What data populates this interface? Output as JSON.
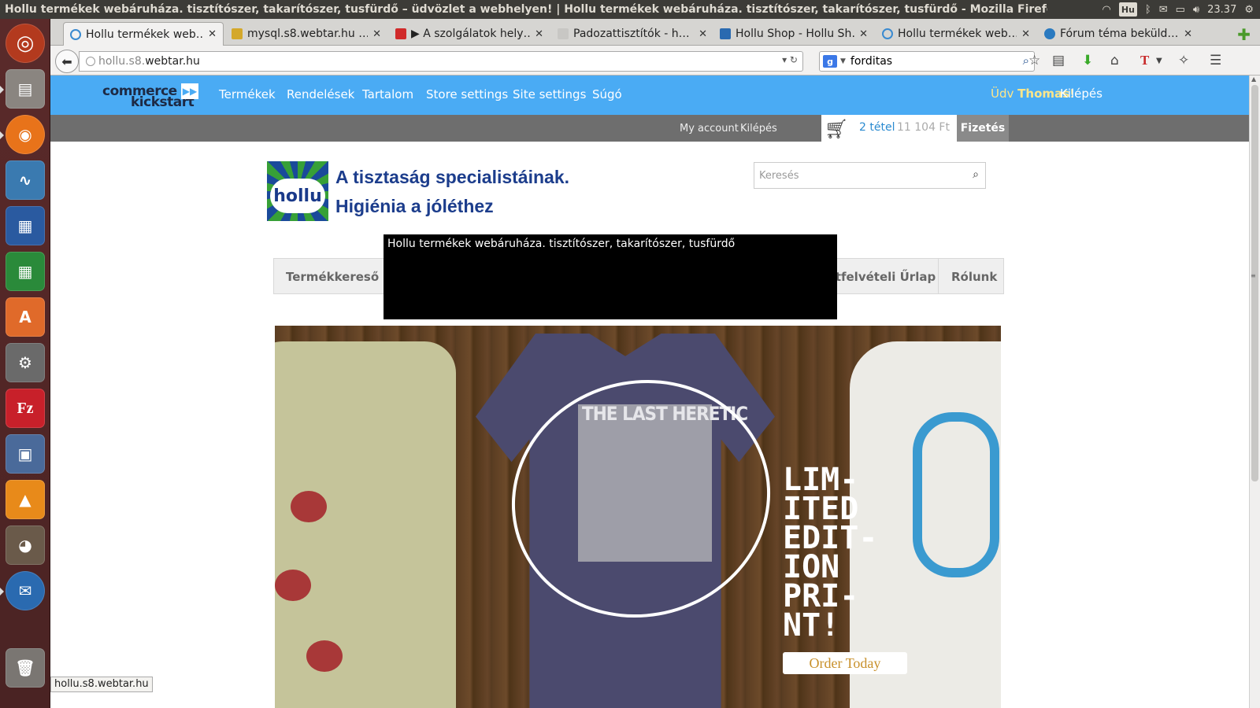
{
  "window": {
    "title": "Hollu termékek webáruháza. tisztítószer, takarítószer, tusfürdő – üdvözlet a webhelyen! | Hollu termékek webáruháza. tisztítószer, takarítószer, tusfürdő - Mozilla Firefox"
  },
  "panel": {
    "keyboard_layout": "Hu",
    "clock": "23.37",
    "icons": [
      "wifi-icon",
      "keyboard-icon",
      "bluetooth-icon",
      "mail-icon",
      "battery-icon",
      "volume-icon",
      "gear-icon"
    ]
  },
  "launcher": {
    "items": [
      "ubuntu-dash",
      "files",
      "firefox",
      "system-monitor",
      "libreoffice-writer",
      "libreoffice-calc",
      "software-center",
      "system-settings",
      "filezilla",
      "screenshot-tool",
      "vlc",
      "gimp",
      "thunderbird",
      "trash"
    ]
  },
  "tabs": [
    {
      "label": "Hollu termékek web…",
      "active": true
    },
    {
      "label": "mysql.s8.webtar.hu …",
      "active": false
    },
    {
      "label": "▶ A szolgálatok hely…",
      "active": false
    },
    {
      "label": "Padozattisztítók - h…",
      "active": false
    },
    {
      "label": "Hollu Shop - Hollu Sh…",
      "active": false
    },
    {
      "label": "Hollu termékek web…",
      "active": false
    },
    {
      "label": "Fórum téma beküld…",
      "active": false
    }
  ],
  "nav": {
    "url_host": "hollu.s8.",
    "url_domain": "webtar.hu",
    "search_value": "forditas"
  },
  "admin": {
    "logo_line1": "commerce",
    "logo_line2": "kickstart",
    "links": [
      "Termékek",
      "Rendelések",
      "Tartalom",
      "Store settings",
      "Site settings",
      "Súgó"
    ],
    "greeting": "Üdv",
    "username": "Thomas",
    "greeting_end": "!",
    "logout": "Kilépés"
  },
  "secbar": {
    "my_account": "My account",
    "logout": "Kilépés",
    "cart_count": "2 tétel",
    "cart_total": "11 104 Ft",
    "checkout": "Fizetés"
  },
  "site": {
    "logo_text": "hollu",
    "tagline1": "A tisztaság specialistáinak.",
    "tagline2": "Higiénia a jóléthez",
    "search_placeholder": "Keresés"
  },
  "menu": {
    "items": [
      "Termékkereső",
      "Ajánlatfelvételi Űrlap",
      "Rólunk"
    ]
  },
  "tooltip": {
    "text": "Hollu termékek webáruháza. tisztítószer, takarítószer, tusfürdő"
  },
  "hero": {
    "shirt_title": "THE LAST HERETIC",
    "headline": "LIM-\nITED\nEDIT-\nION\nPRI-\nNT!",
    "cta": "Order Today"
  },
  "status": {
    "text": "hollu.s8.webtar.hu"
  }
}
